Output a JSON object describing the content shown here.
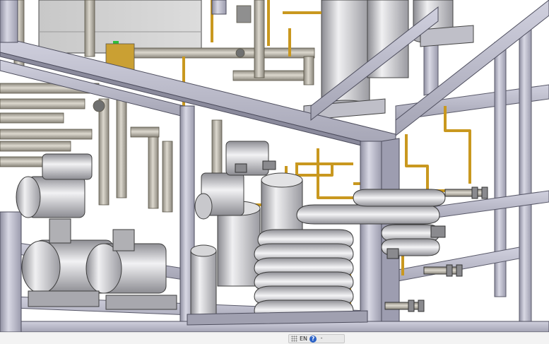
{
  "scene": {
    "frame_color": "#b4b4c4",
    "frame_edge": "#5a5a6a",
    "pipe_color": "#b9b4a8",
    "tube_color": "#d2a227",
    "equipment_color": "#c6c6cc"
  },
  "ime_toolbar": {
    "grip_icon": "grip-icon",
    "language": "EN",
    "help_glyph": "?",
    "minimize_glyph": "-"
  }
}
